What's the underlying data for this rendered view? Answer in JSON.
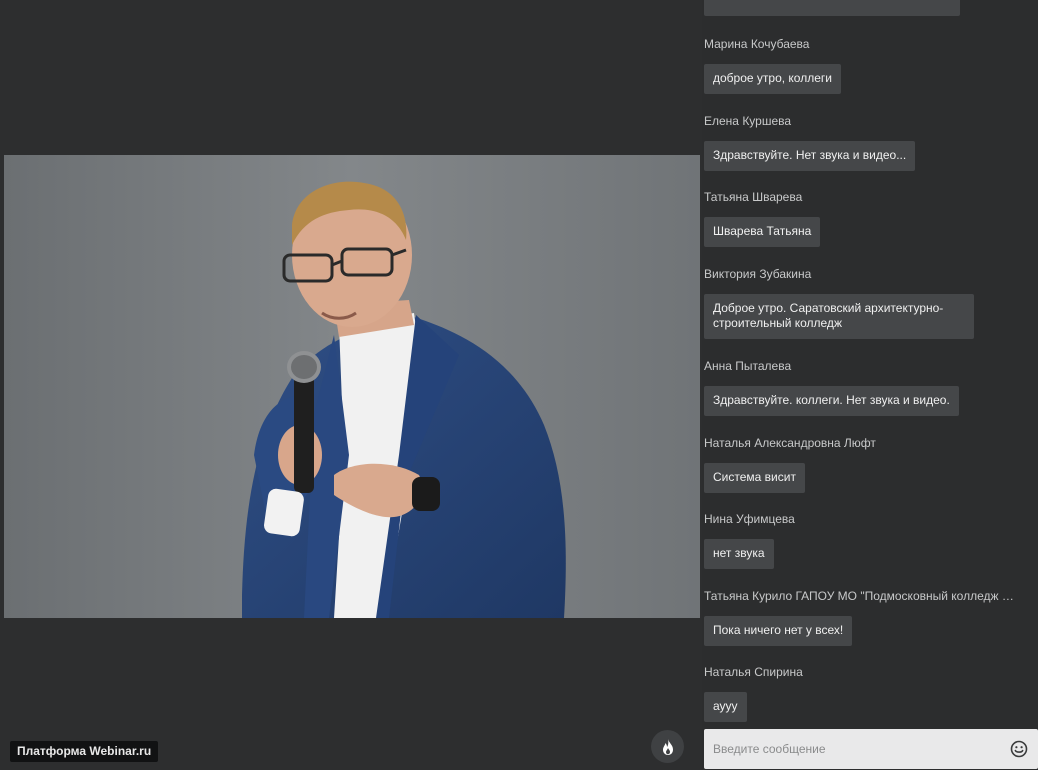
{
  "branding": {
    "platform_label": "Платформа Webinar.ru"
  },
  "video": {
    "icon": "speaker-video-frame"
  },
  "controls": {
    "reaction_icon": "flame-icon"
  },
  "chat": {
    "messages": [
      {
        "author": "Марина Кочубаева",
        "text": "доброе утро, коллеги"
      },
      {
        "author": "Елена Куршева",
        "text": "Здравствуйте. Нет звука и видео..."
      },
      {
        "author": "Татьяна Шварева",
        "text": "Шварева Татьяна"
      },
      {
        "author": "Виктория Зубакина",
        "text": "Доброе утро. Саратовский архитектурно-строительный колледж"
      },
      {
        "author": "Анна Пыталева",
        "text": "Здравствуйте. коллеги. Нет звука и  видео."
      },
      {
        "author": "Наталья Александровна Люфт",
        "text": "Система висит"
      },
      {
        "author": "Нина Уфимцева",
        "text": "нет звука"
      },
      {
        "author": "Татьяна Курило ГАПОУ МО \"Подмосковный колледж \"Э...",
        "text": "Пока ничего нет у всех!"
      },
      {
        "author": "Наталья Спирина",
        "text": "ауyу"
      }
    ],
    "input": {
      "placeholder": "Введите сообщение",
      "value": ""
    },
    "emoji_icon": "smiley-icon"
  },
  "colors": {
    "background": "#2c2d2e",
    "bubble": "#454749",
    "input": "#e9e9ea",
    "badge": "#111213"
  }
}
